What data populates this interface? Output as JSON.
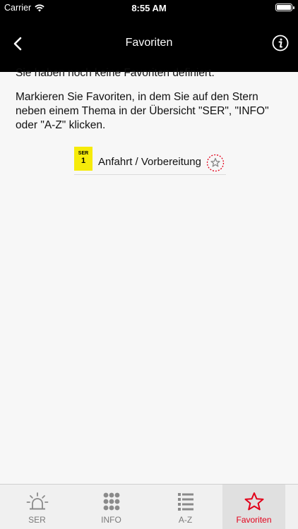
{
  "status": {
    "carrier": "Carrier",
    "time": "8:55 AM"
  },
  "nav": {
    "title": "Favoriten",
    "back_icon": "chevron-left-icon",
    "info_icon": "info-icon"
  },
  "content": {
    "no_favorites": "Sie haben noch keine Favoriten definiert.",
    "instructions": "Markieren Sie Favoriten, in dem Sie auf den Stern neben einem Thema in der Übersicht \"SER\", \"INFO\" oder \"A-Z\" klicken."
  },
  "example_topic": {
    "badge_code": "SER",
    "badge_number": "1",
    "badge_color": "#f6eb0a",
    "label": "Anfahrt / Vorbereitung",
    "star_icon": "star-outline-icon"
  },
  "tabs": [
    {
      "label": "SER",
      "icon": "siren-icon",
      "selected": false
    },
    {
      "label": "INFO",
      "icon": "grid-dots-icon",
      "selected": false
    },
    {
      "label": "A-Z",
      "icon": "list-icon",
      "selected": false
    },
    {
      "label": "Favoriten",
      "icon": "star-icon",
      "selected": true
    }
  ],
  "colors": {
    "accent": "#e2001a",
    "header_bg": "#000000",
    "background": "#f7f7f7"
  }
}
